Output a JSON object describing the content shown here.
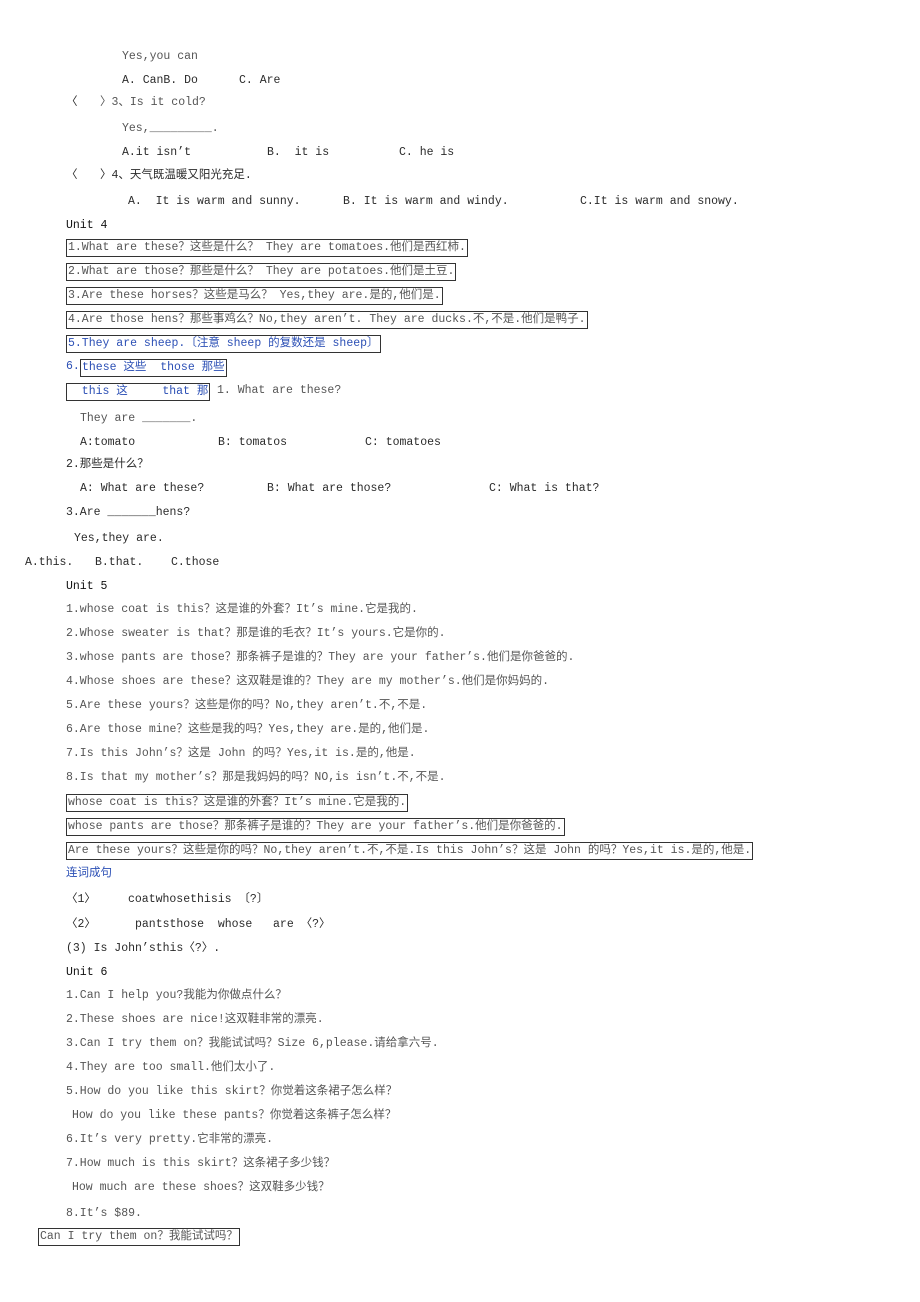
{
  "document": {
    "lines": [
      "Yes,you can",
      "A. CanB. Do",
      "C. Are",
      "〈",
      "〉3、Is it cold?",
      "Yes,_________.",
      "A.it isn’t",
      "B.  it is",
      "C. he is",
      "〈",
      "〉4、天气既温暖又阳光充足.",
      "A.  It is warm and sunny.",
      "B. It is warm and windy.",
      "C.It is warm and snowy.",
      "Unit 4",
      "1.What are these？这些是什么？ They are tomatoes.他们是西红柿.",
      "2.What are those？那些是什么？ They are potatoes.他们是土豆.",
      "3.Are these horses？这些是马么？ Yes,they are.是的,他们是.",
      "4.Are those hens？那些事鸡么？No,they aren’t. They are ducks.不,不是.他们是鸭子.",
      "5.They are sheep.〔注意 sheep 的复数还是 sheep〕",
      "6.",
      "these 这些  those 那些",
      "  this 这     that 那",
      "1. What are these?",
      "They are _______.",
      "A:tomato",
      "B: tomatos",
      "C: tomatoes",
      "2.那些是什么？",
      "A: What are these?",
      "B: What are those?",
      "C: What is that?",
      "3.Are _______hens?",
      "Yes,they are.",
      "A.this.",
      "B.that.",
      "C.those",
      "Unit 5",
      "1.whose coat is this？这是谁的外套？It’s mine.它是我的.",
      "2.Whose sweater is that？那是谁的毛衣？It’s yours.它是你的.",
      "3.whose pants are those？那条裤子是谁的？They are your father’s.他们是你爸爸的.",
      "4.Whose shoes are these？这双鞋是谁的？They are my mother’s.他们是你妈妈的.",
      "5.Are these yours？这些是你的吗？No,they aren’t.不,不是.",
      "6.Are those mine？这些是我的吗？Yes,they are.是的,他们是.",
      "7.Is this John’s？这是 John 的吗？Yes,it is.是的,他是.",
      "8.Is that my mother’s？那是我妈妈的吗？NO,is isn’t.不,不是.",
      "whose coat is this？这是谁的外套？It’s mine.它是我的.",
      "whose pants are those？那条裤子是谁的？They are your father’s.他们是你爸爸的.",
      "Are these yours？这些是你的吗？No,they aren’t.不,不是.Is this John’s？这是 John 的吗？Yes,it is.是的,他是.",
      "连词成句",
      "〈1〉",
      "coatwhosethisis 〔?〕",
      "〈2〉",
      "pantsthose  whose   are 〈?〉",
      "(3) Is John’sthis〈?〉.",
      "Unit 6",
      "1.Can I help you?我能为你做点什么？",
      "2.These shoes are nice!这双鞋非常的漂亮.",
      "3.Can I try them on？我能试试吗？Size 6,please.请给拿六号.",
      "4.They are too small.他们太小了.",
      "5.How do you like this skirt？你觉着这条裙子怎么样？",
      "How do you like these pants？你觉着这条裤子怎么样？",
      "6.It’s very pretty.它非常的漂亮.",
      "7.How much is this skirt？这条裙子多少钱？",
      "How much are these shoes？这双鞋多少钱？",
      "8.It’s $89.",
      "Can I try them on？我能试试吗？"
    ]
  }
}
